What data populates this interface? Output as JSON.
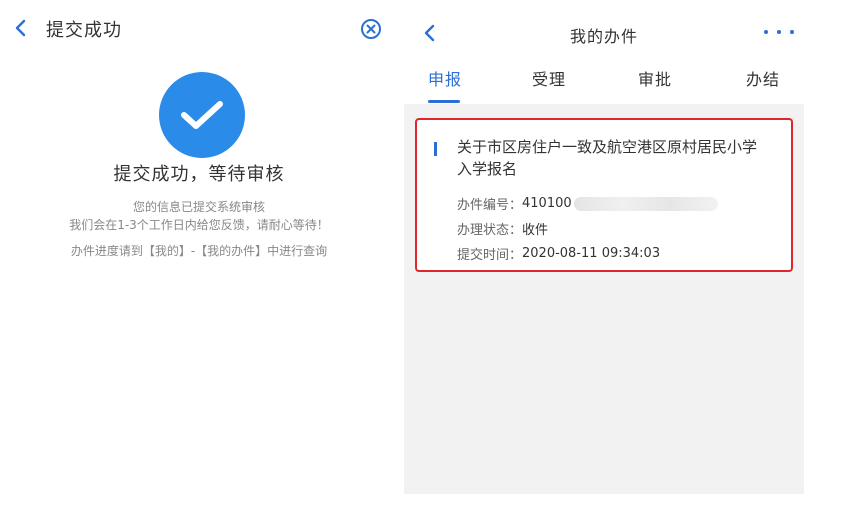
{
  "left": {
    "header": {
      "title": "提交成功"
    },
    "icons": {
      "back": "chevron-left-icon",
      "close": "close-circle-icon",
      "success": "check-circle-icon"
    },
    "success_title": "提交成功，等待审核",
    "info_line_1": "您的信息已提交系统审核",
    "info_line_2": "我们会在1-3个工作日内给您反馈，请耐心等待！",
    "info_line_3": "办件进度请到【我的】-【我的办件】中进行查询"
  },
  "right": {
    "header": {
      "title": "我的办件"
    },
    "icons": {
      "back": "chevron-left-icon",
      "more": "more-dots-icon"
    },
    "tabs": [
      {
        "label": "申报",
        "active": true
      },
      {
        "label": "受理",
        "active": false
      },
      {
        "label": "审批",
        "active": false
      },
      {
        "label": "办结",
        "active": false
      }
    ],
    "card": {
      "title": "关于市区房住户一致及航空港区原村居民小学入学报名",
      "case_number_label": "办件编号：",
      "case_number_value": "410100",
      "status_label": "办理状态：",
      "status_value": "收件",
      "submit_time_label": "提交时间：",
      "submit_time_value": "2020-08-11 09:34:03"
    }
  },
  "colors": {
    "accent": "#2b6fd6",
    "success": "#2b8be8",
    "highlight_border": "#e0262b",
    "list_bg": "#f2f2f2"
  }
}
